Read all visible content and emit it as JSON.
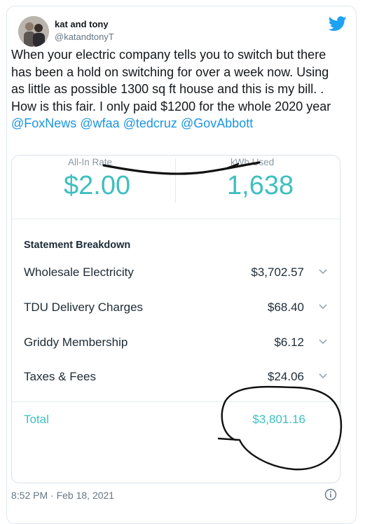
{
  "author": {
    "name": "kat and tony",
    "handle": "@katandtonyT"
  },
  "tweet": {
    "text": "When your electric company tells you to switch but there has been a hold on switching for over  a week now. Using as little as possible 1300 sq ft house and this is my bill. . How is this fair. I only paid $1200 for the whole 2020 year ",
    "mentions": [
      "@FoxNews",
      "@wfaa",
      "@tedcruz",
      "@GovAbbott"
    ]
  },
  "bill": {
    "rate_label": "All-In Rate",
    "rate_value": "$2.00",
    "kwh_label": "kWh Used",
    "kwh_value": "1,638",
    "section_title": "Statement Breakdown",
    "items": [
      {
        "label": "Wholesale Electricity",
        "amount": "$3,702.57"
      },
      {
        "label": "TDU Delivery Charges",
        "amount": "$68.40"
      },
      {
        "label": "Griddy Membership",
        "amount": "$6.12"
      },
      {
        "label": "Taxes & Fees",
        "amount": "$24.06"
      }
    ],
    "total_label": "Total",
    "total_amount": "$3,801.16"
  },
  "meta": {
    "timestamp": "8:52 PM · Feb 18, 2021"
  },
  "colors": {
    "accent": "#3fbfbf",
    "link": "#1b95e0",
    "twitter_blue": "#1da1f2"
  }
}
